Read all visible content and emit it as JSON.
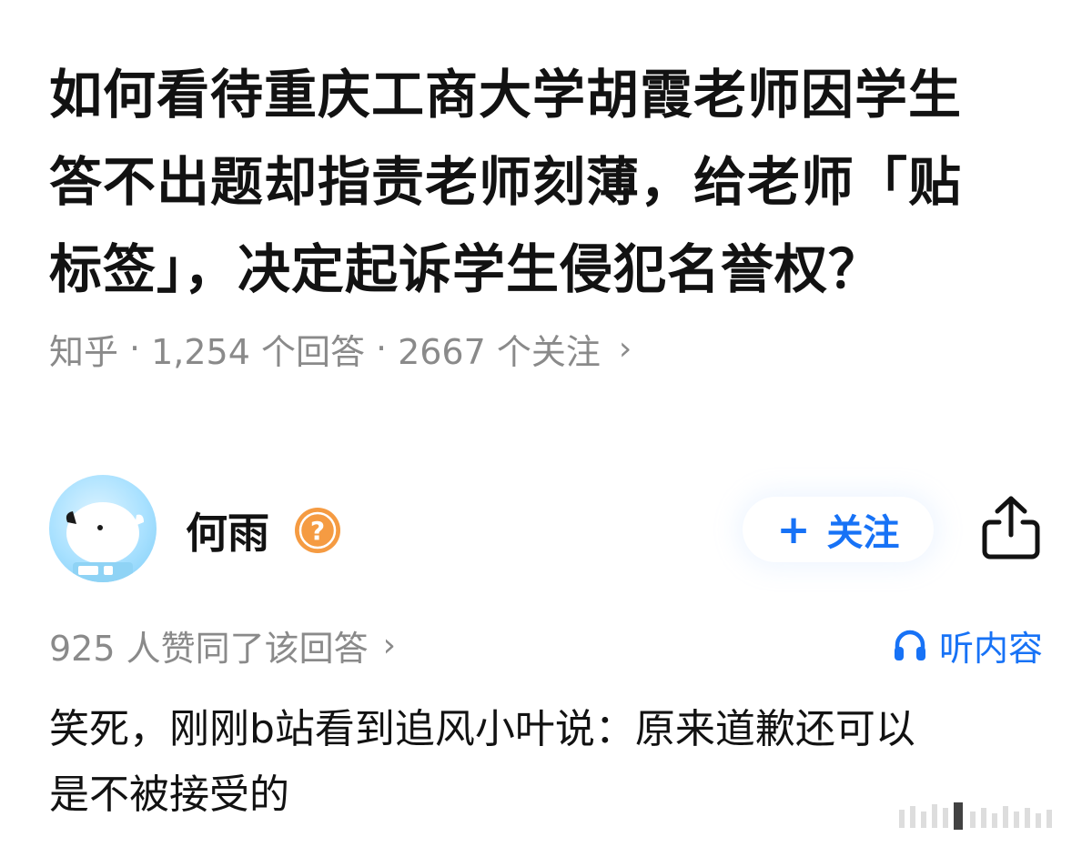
{
  "question": {
    "title_lines": [
      "如何看待重庆工商大学胡霞老师因学生",
      "答不出题却指责老师刻薄，给老师「贴",
      "标签」，决定起诉学生侵犯名誉权？"
    ],
    "source": "知乎",
    "answers_count": "1,254 个回答",
    "followers_count": "2667 个关注",
    "separator": "·",
    "chevron": "›"
  },
  "author": {
    "name": "何雨",
    "badge_symbol": "?",
    "follow_label": "关注",
    "follow_plus": "+"
  },
  "answer": {
    "likes": "925 人赞同了该回答",
    "likes_chevron": "›",
    "listen_label": "听内容",
    "text_lines": [
      "笑死，刚刚b站看到追风小叶说：原来道歉还可以",
      "是不被接受的"
    ]
  },
  "colors": {
    "accent": "#1772f6",
    "text": "#121212",
    "secondary": "#8a8a8a",
    "badge": "#f59b42"
  },
  "icons": {
    "share": "share-icon",
    "headphones": "headphones-icon",
    "badge": "question-badge-icon"
  }
}
